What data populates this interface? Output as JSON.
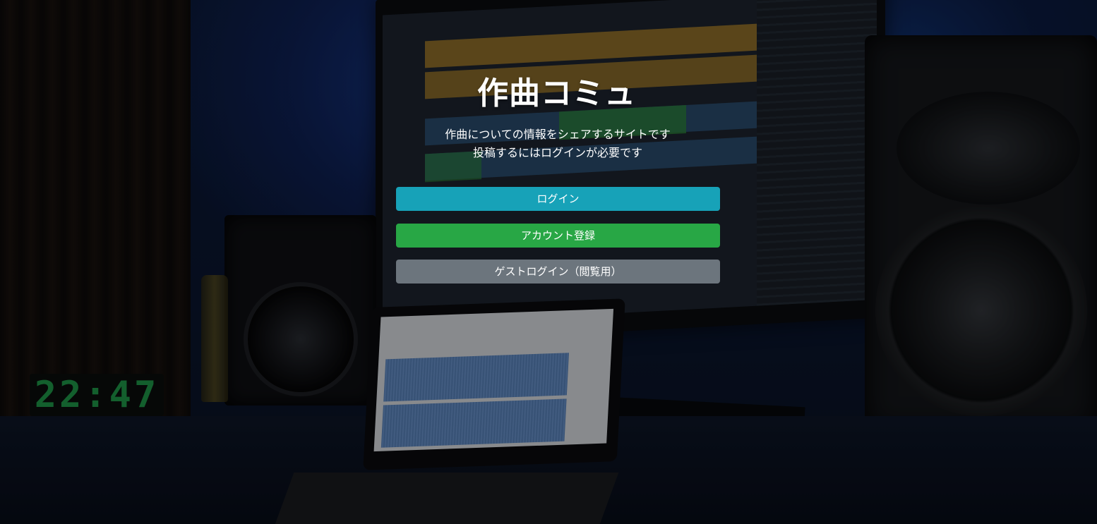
{
  "app": {
    "title": "作曲コミュ",
    "description_line1": "作曲についての情報をシェアするサイトです",
    "description_line2": "投稿するにはログインが必要です"
  },
  "buttons": {
    "login": "ログイン",
    "signup": "アカウント登録",
    "guest_login": "ゲストログイン（閲覧用）"
  },
  "background": {
    "clock_text": "22:47"
  },
  "colors": {
    "login_button": "#17a2b8",
    "signup_button": "#28a745",
    "guest_button": "#6c757d"
  }
}
